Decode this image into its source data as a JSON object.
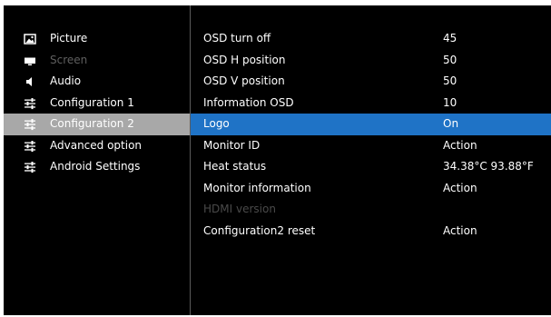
{
  "sidebar": {
    "items": [
      {
        "label": "Picture",
        "icon": "picture-icon"
      },
      {
        "label": "Screen",
        "icon": "screen-icon",
        "state": "disabled"
      },
      {
        "label": "Audio",
        "icon": "speaker-icon"
      },
      {
        "label": "Configuration 1",
        "icon": "sliders-icon"
      },
      {
        "label": "Configuration 2",
        "icon": "sliders-icon",
        "state": "selected"
      },
      {
        "label": "Advanced option",
        "icon": "sliders-icon"
      },
      {
        "label": "Android Settings",
        "icon": "sliders-icon"
      }
    ]
  },
  "settings": {
    "rows": [
      {
        "label": "OSD turn off",
        "value": "45"
      },
      {
        "label": "OSD H position",
        "value": "50"
      },
      {
        "label": "OSD V position",
        "value": "50"
      },
      {
        "label": "Information OSD",
        "value": "10"
      },
      {
        "label": "Logo",
        "value": "On",
        "state": "selected"
      },
      {
        "label": "Monitor ID",
        "value": "Action"
      },
      {
        "label": "Heat status",
        "value": "34.38°C 93.88°F"
      },
      {
        "label": "Monitor information",
        "value": "Action"
      },
      {
        "label": "HDMI version",
        "value": "",
        "state": "disabled"
      },
      {
        "label": "Configuration2 reset",
        "value": "Action"
      }
    ]
  },
  "colors": {
    "background": "#000000",
    "highlight": "#1f73c6",
    "sidebar_selected": "#a8a8a8",
    "disabled_text": "#5f5f5f"
  }
}
